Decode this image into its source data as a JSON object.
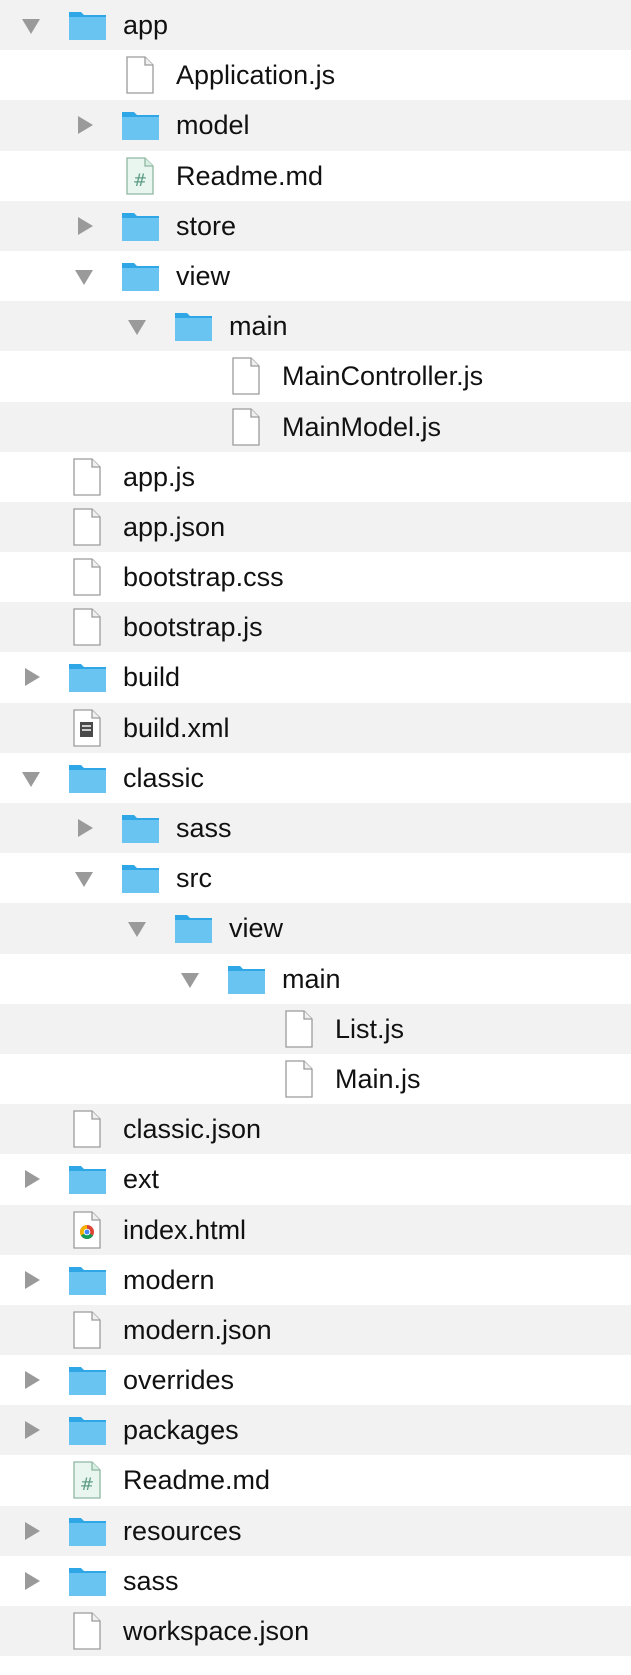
{
  "tree": [
    {
      "label": "app",
      "kind": "folder",
      "depth": 0,
      "state": "open",
      "icon": "folder-icon"
    },
    {
      "label": "Application.js",
      "kind": "file",
      "depth": 1,
      "icon": "document-icon"
    },
    {
      "label": "model",
      "kind": "folder",
      "depth": 1,
      "state": "closed",
      "icon": "folder-icon"
    },
    {
      "label": "Readme.md",
      "kind": "markdown",
      "depth": 1,
      "icon": "markdown-file-icon"
    },
    {
      "label": "store",
      "kind": "folder",
      "depth": 1,
      "state": "closed",
      "icon": "folder-icon"
    },
    {
      "label": "view",
      "kind": "folder",
      "depth": 1,
      "state": "open",
      "icon": "folder-icon"
    },
    {
      "label": "main",
      "kind": "folder",
      "depth": 2,
      "state": "open",
      "icon": "folder-icon"
    },
    {
      "label": "MainController.js",
      "kind": "file",
      "depth": 3,
      "icon": "document-icon"
    },
    {
      "label": "MainModel.js",
      "kind": "file",
      "depth": 3,
      "icon": "document-icon"
    },
    {
      "label": "app.js",
      "kind": "file",
      "depth": 0,
      "icon": "document-icon"
    },
    {
      "label": "app.json",
      "kind": "file",
      "depth": 0,
      "icon": "document-icon"
    },
    {
      "label": "bootstrap.css",
      "kind": "file",
      "depth": 0,
      "icon": "document-icon"
    },
    {
      "label": "bootstrap.js",
      "kind": "file",
      "depth": 0,
      "icon": "document-icon"
    },
    {
      "label": "build",
      "kind": "folder",
      "depth": 0,
      "state": "closed",
      "icon": "folder-icon"
    },
    {
      "label": "build.xml",
      "kind": "xml",
      "depth": 0,
      "icon": "xml-file-icon"
    },
    {
      "label": "classic",
      "kind": "folder",
      "depth": 0,
      "state": "open",
      "icon": "folder-icon"
    },
    {
      "label": "sass",
      "kind": "folder",
      "depth": 1,
      "state": "closed",
      "icon": "folder-icon"
    },
    {
      "label": "src",
      "kind": "folder",
      "depth": 1,
      "state": "open",
      "icon": "folder-icon"
    },
    {
      "label": "view",
      "kind": "folder",
      "depth": 2,
      "state": "open",
      "icon": "folder-icon"
    },
    {
      "label": "main",
      "kind": "folder",
      "depth": 3,
      "state": "open",
      "icon": "folder-icon"
    },
    {
      "label": "List.js",
      "kind": "file",
      "depth": 4,
      "icon": "document-icon"
    },
    {
      "label": "Main.js",
      "kind": "file",
      "depth": 4,
      "icon": "document-icon"
    },
    {
      "label": "classic.json",
      "kind": "file",
      "depth": 0,
      "icon": "document-icon"
    },
    {
      "label": "ext",
      "kind": "folder",
      "depth": 0,
      "state": "closed",
      "icon": "folder-icon"
    },
    {
      "label": "index.html",
      "kind": "html",
      "depth": 0,
      "icon": "chrome-html-file-icon"
    },
    {
      "label": "modern",
      "kind": "folder",
      "depth": 0,
      "state": "closed",
      "icon": "folder-icon"
    },
    {
      "label": "modern.json",
      "kind": "file",
      "depth": 0,
      "icon": "document-icon"
    },
    {
      "label": "overrides",
      "kind": "folder",
      "depth": 0,
      "state": "closed",
      "icon": "folder-icon"
    },
    {
      "label": "packages",
      "kind": "folder",
      "depth": 0,
      "state": "closed",
      "icon": "folder-icon"
    },
    {
      "label": "Readme.md",
      "kind": "markdown",
      "depth": 0,
      "icon": "markdown-file-icon"
    },
    {
      "label": "resources",
      "kind": "folder",
      "depth": 0,
      "state": "closed",
      "icon": "folder-icon"
    },
    {
      "label": "sass",
      "kind": "folder",
      "depth": 0,
      "state": "closed",
      "icon": "folder-icon"
    },
    {
      "label": "workspace.json",
      "kind": "file",
      "depth": 0,
      "icon": "document-icon"
    }
  ],
  "colors": {
    "folder_light": "#69c4f2",
    "folder_dark": "#2fa7e6",
    "row_alt": "#f2f2f2",
    "disclosure": "#9a9a9a"
  }
}
